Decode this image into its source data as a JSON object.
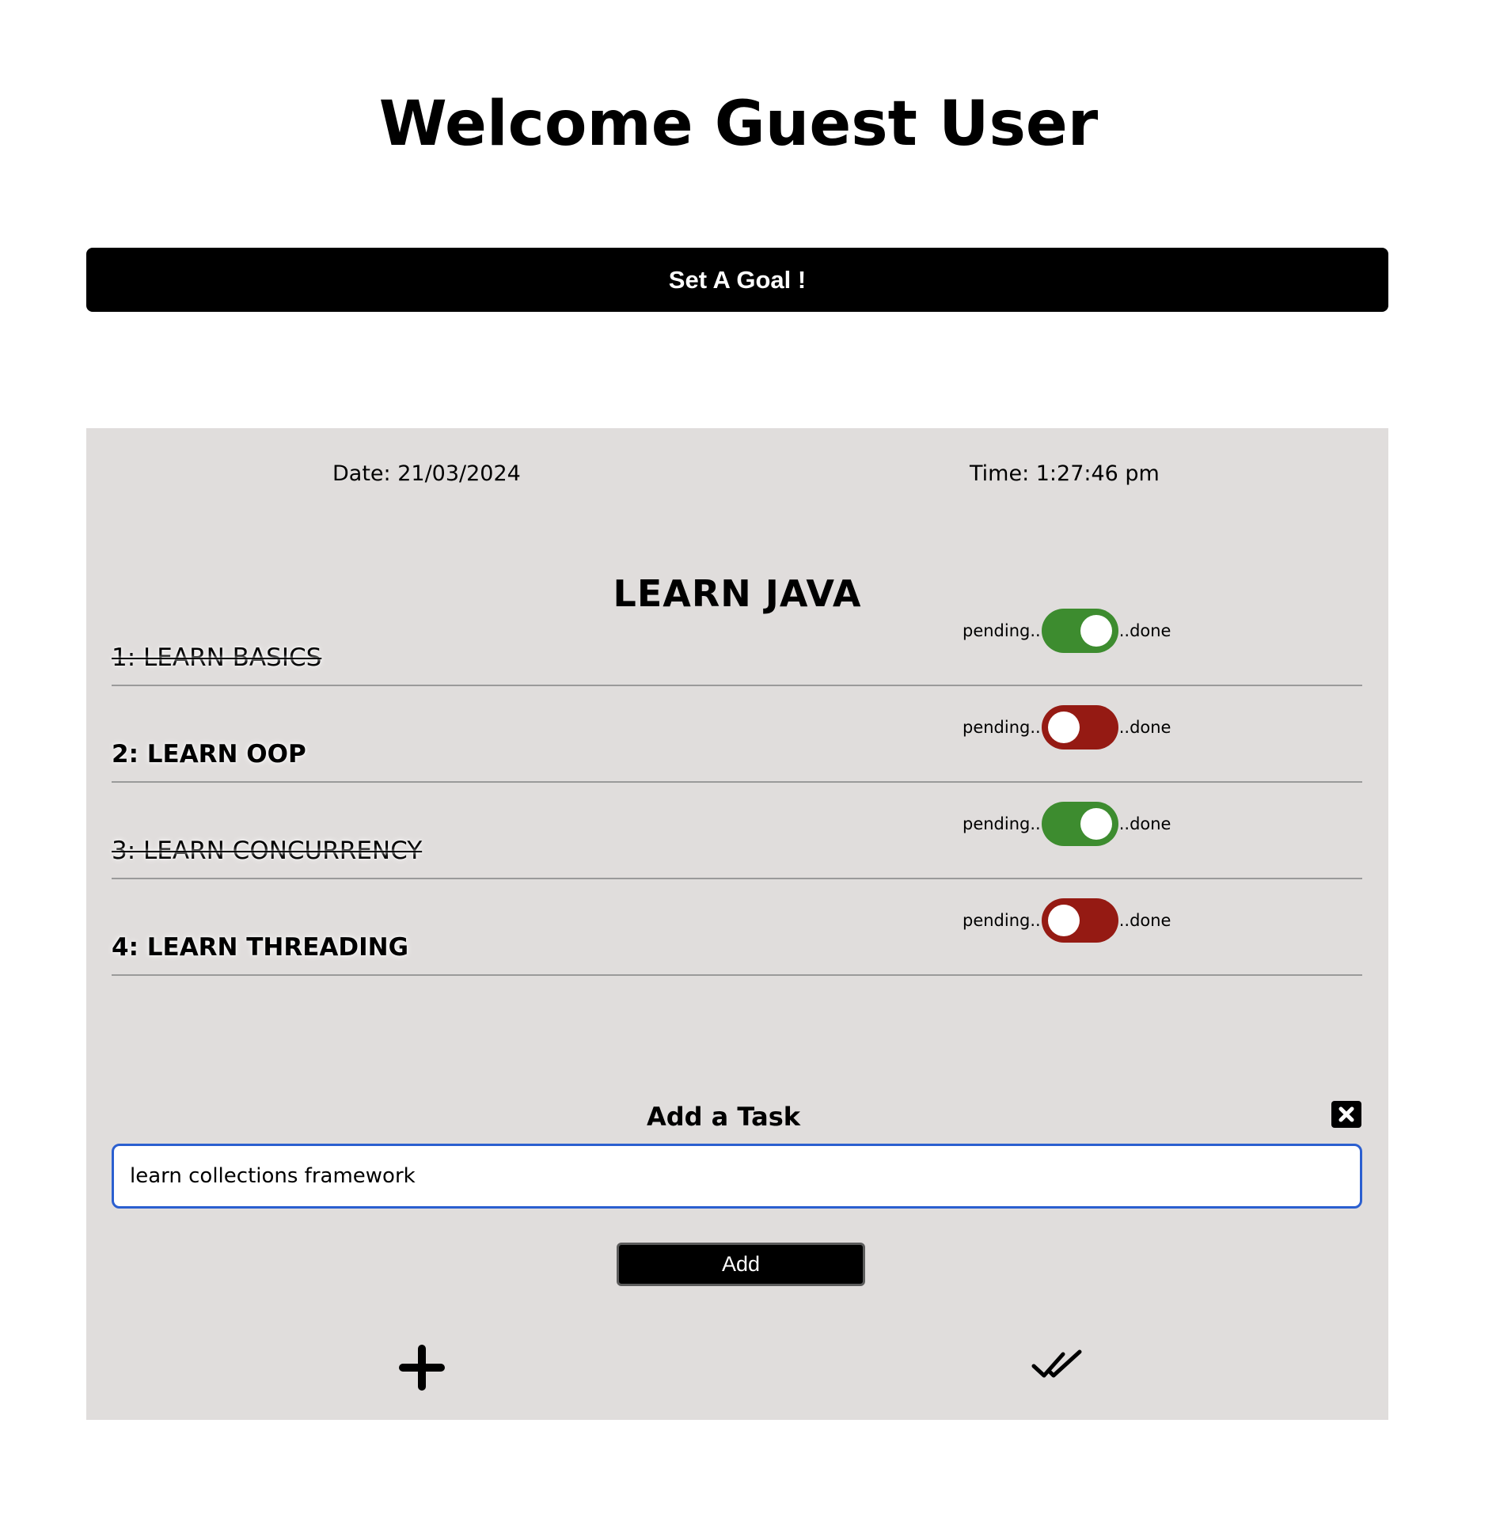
{
  "header": {
    "title": "Welcome Guest User"
  },
  "goal_button": {
    "label": "Set A Goal !"
  },
  "panel": {
    "date": "Date: 21/03/2024",
    "time": "Time: 1:27:46 pm",
    "goal_title": "LEARN JAVA",
    "tasks": [
      {
        "label": "1: LEARN BASICS",
        "status": "done",
        "pending_label": "pending..",
        "done_label": "..done"
      },
      {
        "label": "2: LEARN OOP",
        "status": "pending",
        "pending_label": "pending..",
        "done_label": "..done"
      },
      {
        "label": "3: LEARN CONCURRENCY",
        "status": "done",
        "pending_label": "pending..",
        "done_label": "..done"
      },
      {
        "label": "4: LEARN THREADING",
        "status": "pending",
        "pending_label": "pending..",
        "done_label": "..done"
      }
    ],
    "add_task": {
      "title": "Add a Task",
      "input_value": "learn collections framework",
      "button_label": "Add"
    },
    "icons": {
      "close": "close-icon",
      "add": "plus-icon",
      "complete": "double-check-icon"
    }
  },
  "colors": {
    "panel_background": "#e0dddc",
    "toggle_on": "#3d8c2f",
    "toggle_off": "#951a13",
    "input_border": "#2b5fd0"
  }
}
